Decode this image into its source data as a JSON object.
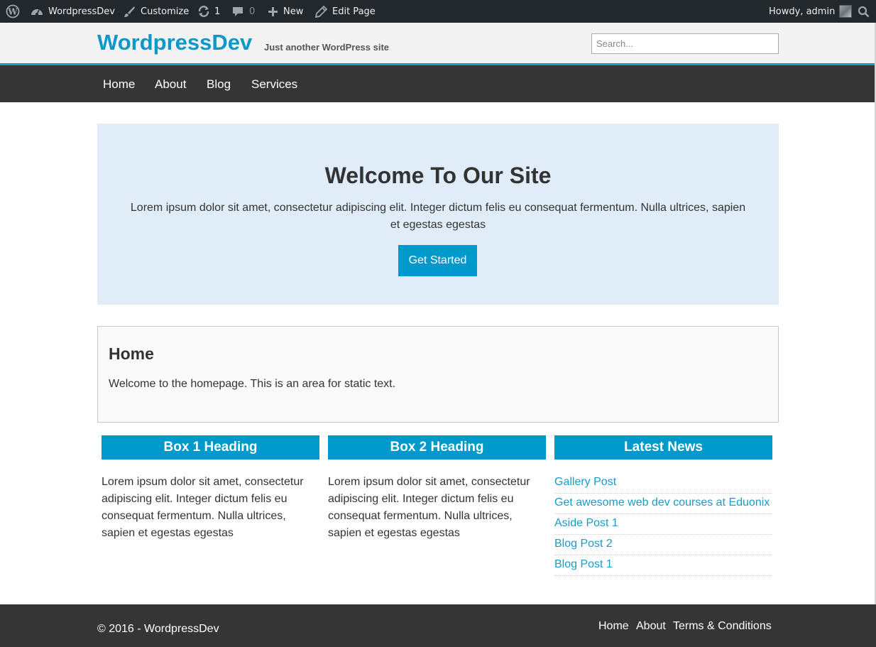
{
  "adminbar": {
    "site_name": "WordpressDev",
    "customize": "Customize",
    "updates_count": "1",
    "comments_count": "0",
    "new_label": "New",
    "edit_page": "Edit Page",
    "howdy": "Howdy, admin",
    "icons": [
      "wordpress-logo-icon",
      "dashboard-icon",
      "brush-icon",
      "updates-icon",
      "comment-icon",
      "plus-icon",
      "pencil-icon",
      "avatar",
      "search-icon"
    ]
  },
  "header": {
    "site_title": "WordpressDev",
    "tagline": "Just another WordPress site",
    "search_placeholder": "Search..."
  },
  "nav": {
    "items": [
      "Home",
      "About",
      "Blog",
      "Services"
    ]
  },
  "hero": {
    "title": "Welcome To Our Site",
    "text": "Lorem ipsum dolor sit amet, consectetur adipiscing elit. Integer dictum felis eu consequat fermentum. Nulla ultrices, sapien et egestas egestas",
    "button": "Get Started"
  },
  "home": {
    "title": "Home",
    "text": "Welcome to the homepage. This is an area for static text."
  },
  "boxes": [
    {
      "heading": "Box 1 Heading",
      "text": "Lorem ipsum dolor sit amet, consectetur adipiscing elit. Integer dictum felis eu consequat fermentum. Nulla ultrices, sapien et egestas egestas"
    },
    {
      "heading": "Box 2 Heading",
      "text": "Lorem ipsum dolor sit amet, consectetur adipiscing elit. Integer dictum felis eu consequat fermentum. Nulla ultrices, sapien et egestas egestas"
    }
  ],
  "latest_news": {
    "heading": "Latest News",
    "items": [
      "Gallery Post",
      "Get awesome web dev courses at Eduonix",
      "Aside Post 1",
      "Blog Post 2",
      "Blog Post 1"
    ]
  },
  "footer": {
    "copyright": "© 2016 - WordpressDev",
    "links": [
      "Home",
      "About",
      "Terms & Conditions"
    ]
  },
  "colors": {
    "adminbar_bg": "#23282d",
    "accent": "#0099cc",
    "nav_bg": "#353535",
    "hero_bg": "#e0edf9",
    "title_blue": "#0e97c9"
  }
}
